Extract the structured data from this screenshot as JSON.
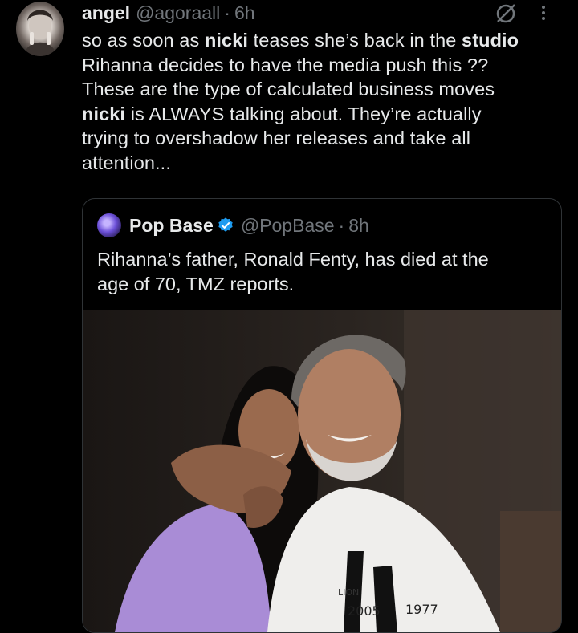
{
  "tweet": {
    "name": "angel",
    "handle": "@agoraall",
    "sep": "·",
    "time": "6h",
    "segments": [
      {
        "t": "so as soon as ",
        "b": false
      },
      {
        "t": "nicki",
        "b": true
      },
      {
        "t": " teases she’s back in the ",
        "b": false
      },
      {
        "t": "studio",
        "b": true
      },
      {
        "t": "\nRihanna decides to have the media push this ??\nThese are the type of calculated business moves\n",
        "b": false
      },
      {
        "t": "nicki",
        "b": true
      },
      {
        "t": " is ALWAYS talking about. They’re actually\ntrying to overshadow her releases and take all\nattention...",
        "b": false
      }
    ]
  },
  "quote": {
    "name": "Pop Base",
    "handle": "@PopBase",
    "sep": "·",
    "time": "8h",
    "text": "Rihanna’s father, Ronald Fenty, has died at the\nage of 70, TMZ reports.",
    "shirt_text_1": "LION",
    "shirt_text_2": "1977",
    "shirt_text_3": "2005"
  },
  "colors": {
    "background": "#000000",
    "text": "#e7e9ea",
    "muted": "#71767b",
    "verified": "#1d9bf0",
    "border": "#2f3336"
  },
  "icons": [
    "grok-icon",
    "more-icon",
    "verified-badge-icon"
  ]
}
